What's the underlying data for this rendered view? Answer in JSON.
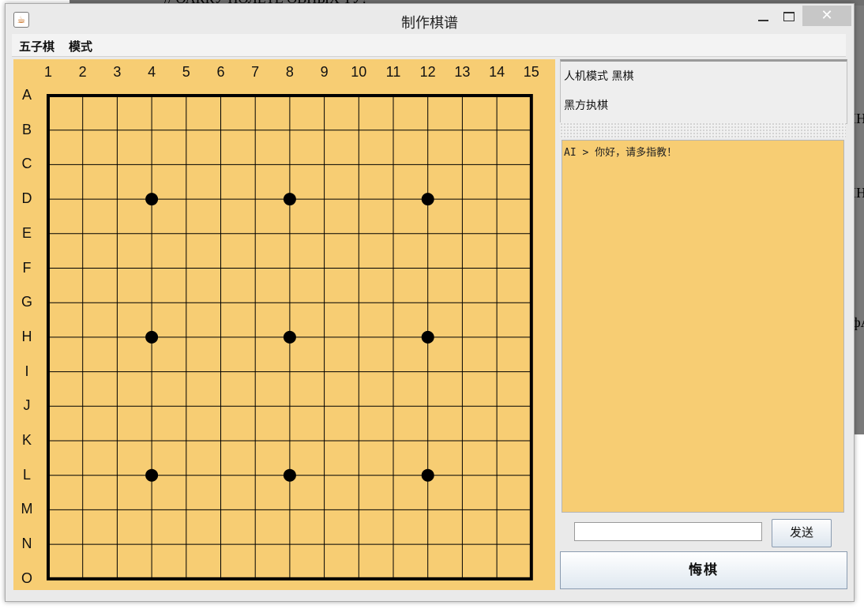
{
  "background_window": {
    "fragment_top": "// ОАККУ ПОЛЕТЕ ОВНЫХ ТУ!",
    "fragment_right_1": "IH",
    "fragment_right_2": "IH",
    "fragment_right_3": "фА"
  },
  "window": {
    "title": "制作棋谱",
    "icon": "java-coffee-icon",
    "close_glyph": "✕"
  },
  "menu": {
    "items": [
      {
        "label": "五子棋"
      },
      {
        "label": "模式"
      }
    ]
  },
  "board": {
    "size": 15,
    "columns": [
      "1",
      "2",
      "3",
      "4",
      "5",
      "6",
      "7",
      "8",
      "9",
      "10",
      "11",
      "12",
      "13",
      "14",
      "15"
    ],
    "rows": [
      "A",
      "B",
      "C",
      "D",
      "E",
      "F",
      "G",
      "H",
      "I",
      "J",
      "K",
      "L",
      "M",
      "N",
      "O"
    ],
    "background_color": "#f7cd73",
    "line_color": "#000000",
    "star_points": [
      {
        "row": "D",
        "col": 4
      },
      {
        "row": "D",
        "col": 8
      },
      {
        "row": "D",
        "col": 12
      },
      {
        "row": "H",
        "col": 4
      },
      {
        "row": "H",
        "col": 8
      },
      {
        "row": "H",
        "col": 12
      },
      {
        "row": "L",
        "col": 4
      },
      {
        "row": "L",
        "col": 8
      },
      {
        "row": "L",
        "col": 12
      }
    ]
  },
  "status": {
    "mode_line": "人机模式  黑棋",
    "turn_line": "黑方执棋"
  },
  "chat": {
    "messages": [
      "AI > 你好，请多指教！"
    ],
    "input_value": "",
    "send_label": "发送"
  },
  "undo_label": "悔棋"
}
